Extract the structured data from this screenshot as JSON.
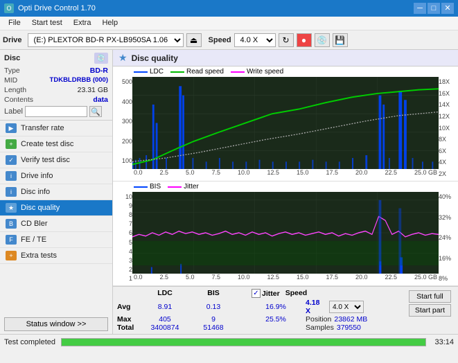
{
  "titleBar": {
    "title": "Opti Drive Control 1.70",
    "minBtn": "─",
    "maxBtn": "□",
    "closeBtn": "✕"
  },
  "menuBar": {
    "items": [
      "File",
      "Start test",
      "Extra",
      "Help"
    ]
  },
  "driveToolbar": {
    "label": "Drive",
    "driveValue": "(E:) PLEXTOR BD-R  PX-LB950SA 1.06",
    "speedLabel": "Speed",
    "speedValue": "4.0 X",
    "ejectIcon": "⏏"
  },
  "sidebar": {
    "discSection": {
      "title": "Disc",
      "rows": [
        {
          "key": "Type",
          "val": "BD-R",
          "valClass": "disc-val"
        },
        {
          "key": "MID",
          "val": "TDKBLDRBB (000)",
          "valClass": "disc-val"
        },
        {
          "key": "Length",
          "val": "23.31 GB",
          "valClass": "disc-val-black"
        },
        {
          "key": "Contents",
          "val": "data",
          "valClass": "disc-val"
        },
        {
          "key": "Label",
          "val": "",
          "valClass": "disc-val"
        }
      ]
    },
    "navItems": [
      {
        "label": "Transfer rate",
        "id": "transfer-rate",
        "iconColor": "blue"
      },
      {
        "label": "Create test disc",
        "id": "create-test-disc",
        "iconColor": "green"
      },
      {
        "label": "Verify test disc",
        "id": "verify-test-disc",
        "iconColor": "blue"
      },
      {
        "label": "Drive info",
        "id": "drive-info",
        "iconColor": "blue"
      },
      {
        "label": "Disc info",
        "id": "disc-info",
        "iconColor": "blue"
      },
      {
        "label": "Disc quality",
        "id": "disc-quality",
        "iconColor": "blue",
        "active": true
      },
      {
        "label": "CD Bler",
        "id": "cd-bler",
        "iconColor": "blue"
      },
      {
        "label": "FE / TE",
        "id": "fe-te",
        "iconColor": "blue"
      },
      {
        "label": "Extra tests",
        "id": "extra-tests",
        "iconColor": "orange"
      }
    ],
    "statusBtn": "Status window >>"
  },
  "contentHeader": {
    "title": "Disc quality"
  },
  "chart1": {
    "legend": [
      {
        "label": "LDC",
        "color": "#0044ff"
      },
      {
        "label": "Read speed",
        "color": "#00bb00"
      },
      {
        "label": "Write speed",
        "color": "#ff00ff"
      }
    ],
    "yAxisLeft": [
      "500",
      "400",
      "300",
      "200",
      "100"
    ],
    "yAxisRight": [
      "18X",
      "16X",
      "14X",
      "12X",
      "10X",
      "8X",
      "6X",
      "4X",
      "2X"
    ],
    "xAxis": [
      "0.0",
      "2.5",
      "5.0",
      "7.5",
      "10.0",
      "12.5",
      "15.0",
      "17.5",
      "20.0",
      "22.5",
      "25.0 GB"
    ]
  },
  "chart2": {
    "legend": [
      {
        "label": "BIS",
        "color": "#0044ff"
      },
      {
        "label": "Jitter",
        "color": "#ff00ff"
      }
    ],
    "yAxisLeft": [
      "10",
      "9",
      "8",
      "7",
      "6",
      "5",
      "4",
      "3",
      "2",
      "1"
    ],
    "yAxisRight": [
      "40%",
      "32%",
      "24%",
      "16%",
      "8%"
    ],
    "xAxis": [
      "0.0",
      "2.5",
      "5.0",
      "7.5",
      "10.0",
      "12.5",
      "15.0",
      "17.5",
      "20.0",
      "22.5",
      "25.0 GB"
    ]
  },
  "stats": {
    "headers": [
      "LDC",
      "BIS",
      "",
      "Jitter",
      "Speed",
      ""
    ],
    "rows": [
      {
        "label": "Avg",
        "ldc": "8.91",
        "bis": "0.13",
        "jitter": "16.9%",
        "speed": "4.18 X",
        "speedTarget": "4.0 X"
      },
      {
        "label": "Max",
        "ldc": "405",
        "bis": "9",
        "jitter": "25.5%",
        "position": "23862 MB"
      },
      {
        "label": "Total",
        "ldc": "3400874",
        "bis": "51468",
        "samples": "379550"
      }
    ],
    "jitterChecked": true,
    "jitterLabel": "Jitter",
    "speedLabel": "Speed",
    "positionLabel": "Position",
    "samplesLabel": "Samples",
    "startFullBtn": "Start full",
    "startPartBtn": "Start part"
  },
  "statusBar": {
    "text": "Test completed",
    "progress": 100,
    "time": "33:14"
  }
}
